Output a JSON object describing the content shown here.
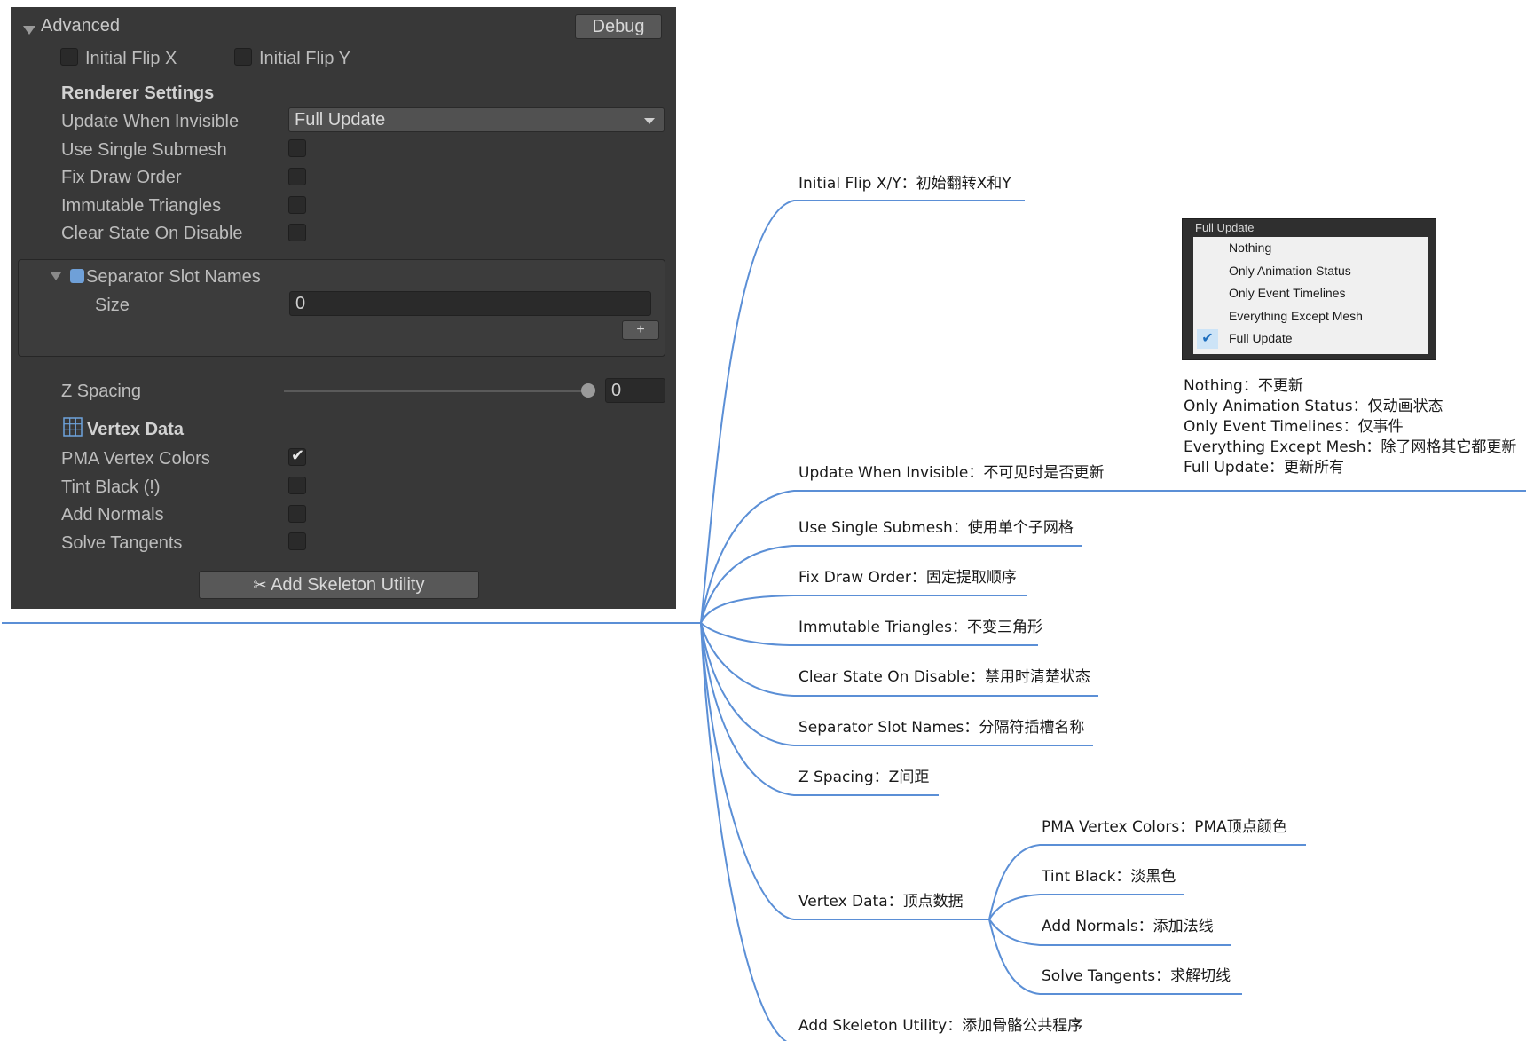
{
  "inspector": {
    "section_title": "Advanced",
    "debug_button": "Debug",
    "initial_flip_x": "Initial Flip X",
    "initial_flip_y": "Initial Flip Y",
    "renderer_settings": "Renderer Settings",
    "update_when_invisible_label": "Update When Invisible",
    "update_when_invisible_value": "Full Update",
    "use_single_submesh": "Use Single Submesh",
    "fix_draw_order": "Fix Draw Order",
    "immutable_triangles": "Immutable Triangles",
    "clear_state_on_disable": "Clear State On Disable",
    "separator_slot_names": "Separator Slot Names",
    "size_label": "Size",
    "size_value": "0",
    "add_button": "+",
    "z_spacing_label": "Z Spacing",
    "z_spacing_value": "0",
    "vertex_data": "Vertex Data",
    "pma_vertex_colors": "PMA Vertex Colors",
    "tint_black": "Tint Black (!)",
    "add_normals": "Add Normals",
    "solve_tangents": "Solve Tangents",
    "add_skeleton_utility": "Add Skeleton Utility",
    "pma_checked": true
  },
  "popup": {
    "title": "Full Update",
    "options": [
      "Nothing",
      "Only Animation Status",
      "Only Event Timelines",
      "Everything Except Mesh",
      "Full Update"
    ],
    "selected": "Full Update"
  },
  "mindmap": {
    "line_color": "#5b8fd6",
    "nodes": {
      "initial_flip": "Initial Flip X/Y：初始翻转X和Y",
      "update_when_invisible": "Update When Invisible：不可见时是否更新",
      "use_single_submesh": "Use Single Submesh：使用单个子网格",
      "fix_draw_order": "Fix Draw Order：固定提取顺序",
      "immutable_triangles": "Immutable Triangles：不变三角形",
      "clear_state": "Clear State On Disable：禁用时清楚状态",
      "separator_slot_names": "Separator Slot Names：分隔符插槽名称",
      "z_spacing": "Z Spacing：Z间距",
      "vertex_data": "Vertex Data：顶点数据",
      "pma_vertex_colors": "PMA Vertex Colors：PMA顶点颜色",
      "tint_black": "Tint Black：淡黑色",
      "add_normals": "Add Normals：添加法线",
      "solve_tangents": "Solve Tangents：求解切线",
      "add_skeleton_utility": "Add Skeleton Utility：添加骨骼公共程序"
    },
    "update_notes": [
      "Nothing：不更新",
      "Only Animation Status：仅动画状态",
      "Only Event Timelines：仅事件",
      "Everything Except Mesh：除了网格其它都更新",
      "Full Update：更新所有"
    ]
  }
}
